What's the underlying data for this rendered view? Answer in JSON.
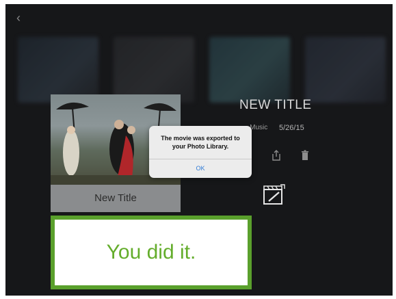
{
  "nav": {
    "back_glyph": "‹"
  },
  "poster": {
    "caption": "New Title"
  },
  "details": {
    "title": "NEW TITLE",
    "meta_left": "... Music",
    "meta_right": "5/26/15"
  },
  "icons": [
    "back-icon",
    "share-icon",
    "trash-icon",
    "clapperboard-edit-icon"
  ],
  "alert": {
    "message": "The movie was exported to your Photo Library.",
    "ok_label": "OK"
  },
  "callout": {
    "text": "You did it."
  },
  "colors": {
    "background": "#1e1f21",
    "accent_green": "#5aa02c",
    "ios_blue": "#2f7bd6"
  }
}
